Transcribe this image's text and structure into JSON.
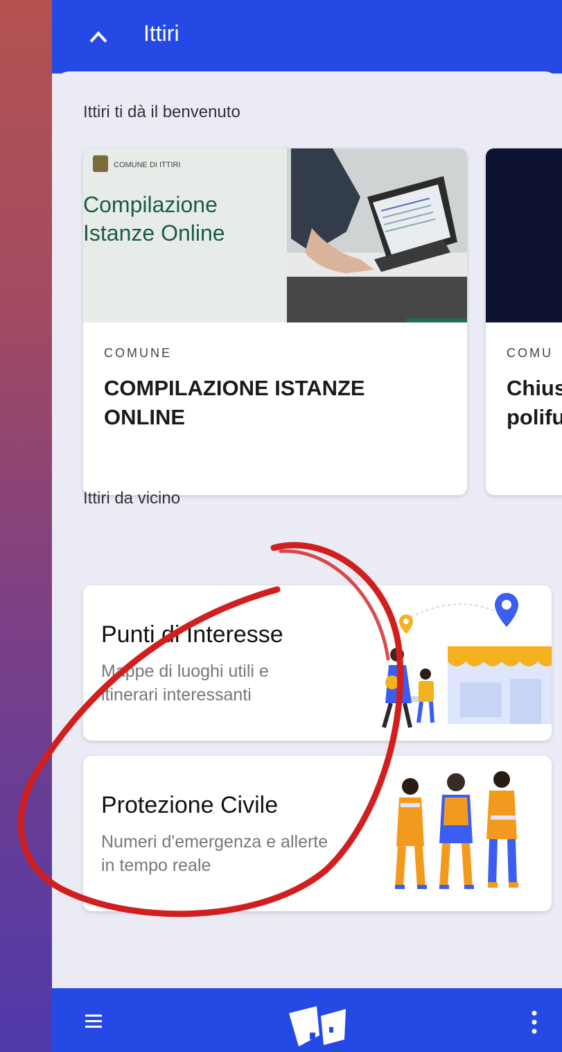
{
  "header": {
    "title": "Ittiri"
  },
  "welcome": {
    "title": "Ittiri ti dà il benvenuto",
    "cards": [
      {
        "image_brand": "COMUNE DI ITTIRI",
        "image_title_line1": "Compilazione",
        "image_title_line2": "Istanze Online",
        "category": "COMUNE",
        "title": "COMPILAZIONE ISTANZE ONLINE"
      },
      {
        "category": "COMU",
        "title_line1": "Chius",
        "title_line2": "polifu"
      }
    ]
  },
  "nearby": {
    "title": "Ittiri da vicino",
    "items": [
      {
        "title": "Punti di Interesse",
        "subtitle": "Mappe di luoghi utili e itinerari interessanti"
      },
      {
        "title": "Protezione Civile",
        "subtitle": "Numeri d'emergenza e allerte in tempo reale"
      }
    ]
  },
  "colors": {
    "primary": "#2549e4",
    "background": "#eaebf4",
    "annotation": "#d11f1f"
  },
  "icons": {
    "header": "chevron-up-icon",
    "bottom_left": "menu-icon",
    "bottom_center": "app-logo-icon",
    "bottom_right": "more-vertical-icon"
  }
}
